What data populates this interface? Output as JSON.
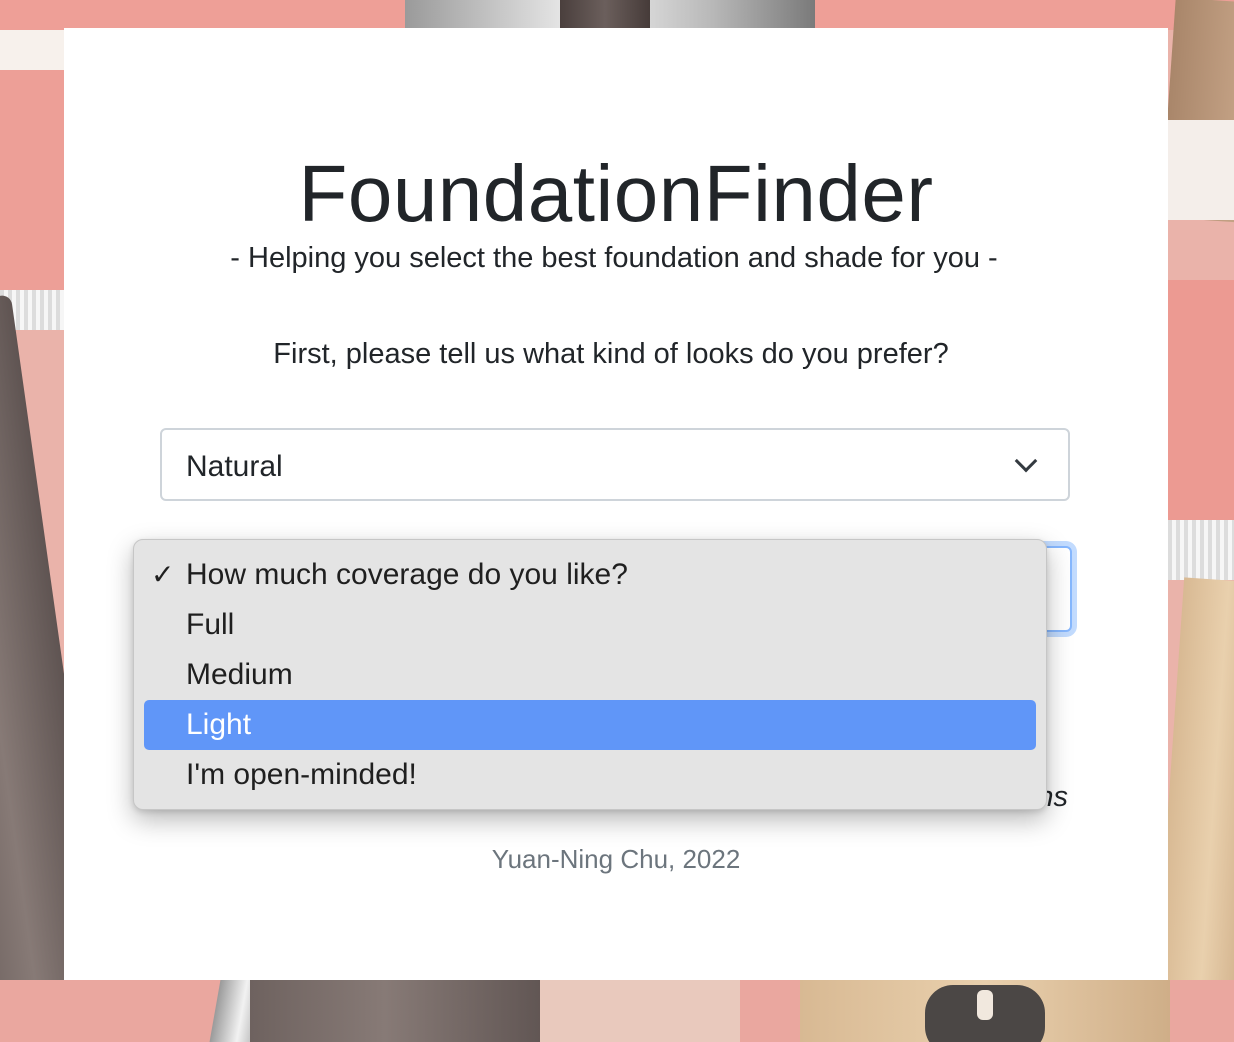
{
  "page": {
    "title": "FoundationFinder",
    "subtitle": "- Helping you select the best foundation and shade for you -",
    "question": "First, please tell us what kind of looks do you prefer?",
    "footer_italic": "ns",
    "credit": "Yuan-Ning Chu, 2022"
  },
  "look_select": {
    "value": "Natural",
    "icon": "chevron-down-icon"
  },
  "coverage_dropdown": {
    "options": [
      {
        "label": "How much coverage do you like?",
        "checked": true
      },
      {
        "label": "Full",
        "checked": false
      },
      {
        "label": "Medium",
        "checked": false
      },
      {
        "label": "Light",
        "checked": false,
        "highlighted": true
      },
      {
        "label": "I'm open-minded!",
        "checked": false
      }
    ],
    "check_glyph": "✓",
    "highlight_color": "#6096f8"
  },
  "colors": {
    "card": "#ffffff",
    "text": "#212529",
    "muted": "#6c757d",
    "focus_ring": "#86b7fe",
    "background_pink": "#eab3aa"
  }
}
